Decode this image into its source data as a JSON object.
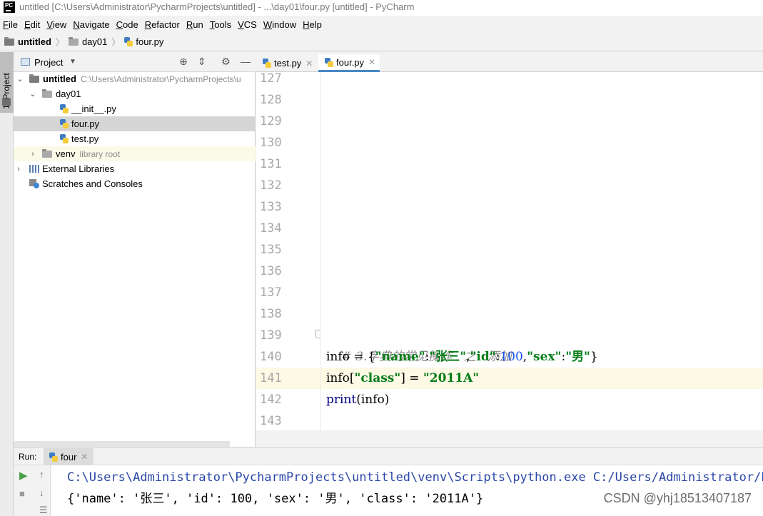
{
  "window": {
    "title": "untitled [C:\\Users\\Administrator\\PycharmProjects\\untitled] - ...\\day01\\four.py [untitled] - PyCharm",
    "logo_text": "PC"
  },
  "menubar": {
    "items": [
      {
        "label": "File",
        "mnemonic": "F",
        "rest": "ile"
      },
      {
        "label": "Edit",
        "mnemonic": "E",
        "rest": "dit"
      },
      {
        "label": "View",
        "mnemonic": "V",
        "rest": "iew"
      },
      {
        "label": "Navigate",
        "mnemonic": "N",
        "rest": "avigate"
      },
      {
        "label": "Code",
        "mnemonic": "C",
        "rest": "ode"
      },
      {
        "label": "Refactor",
        "mnemonic": "R",
        "rest": "efactor"
      },
      {
        "label": "Run",
        "mnemonic": "R",
        "rest": "un"
      },
      {
        "label": "Tools",
        "mnemonic": "T",
        "rest": "ools"
      },
      {
        "label": "VCS",
        "mnemonic": "V",
        "rest": "CS"
      },
      {
        "label": "Window",
        "mnemonic": "W",
        "rest": "indow"
      },
      {
        "label": "Help",
        "mnemonic": "H",
        "rest": "elp"
      }
    ]
  },
  "breadcrumb": {
    "project": "untitled",
    "folder": "day01",
    "file": "four.py"
  },
  "left_strip": {
    "tab_label": "1: Project"
  },
  "project_panel": {
    "title": "Project",
    "tree": {
      "root": {
        "label": "untitled",
        "path": "C:\\Users\\Administrator\\PycharmProjects\\u"
      },
      "day01": "day01",
      "init": "__init__.py",
      "four": "four.py",
      "test": "test.py",
      "venv": {
        "label": "venv",
        "note": "library root"
      },
      "external": "External Libraries",
      "scratches": "Scratches and Consoles"
    }
  },
  "editor_tabs": [
    {
      "label": "test.py",
      "active": false
    },
    {
      "label": "four.py",
      "active": true
    }
  ],
  "editor": {
    "line_numbers": [
      "127",
      "128",
      "129",
      "130",
      "131",
      "132",
      "133",
      "134",
      "135",
      "136",
      "137",
      "138",
      "139",
      "140",
      "141",
      "142",
      "143"
    ],
    "current_line": "141",
    "code": {
      "l139_comment": "# 3.字典的常见操作   之   添加",
      "l140_var": "info = {",
      "l140_k1": "\"name\"",
      "l140_c1": ":",
      "l140_v1": "\"张三\"",
      "l140_s1": ",",
      "l140_k2": "\"id\"",
      "l140_c2": ":",
      "l140_v2": "100",
      "l140_s2": ",",
      "l140_k3": "\"sex\"",
      "l140_c3": ":",
      "l140_v3": "\"男\"",
      "l140_end": "}",
      "l141_a": "info[",
      "l141_k": "\"class\"",
      "l141_b": "] = ",
      "l141_v": "\"2011A\"",
      "l142_fn": "print",
      "l142_args": "(info)"
    }
  },
  "run_panel": {
    "label": "Run:",
    "tab": "four",
    "console": {
      "line1": "C:\\Users\\Administrator\\PycharmProjects\\untitled\\venv\\Scripts\\python.exe C:/Users/Administrator/Pyc",
      "line2": "{'name': '张三', 'id': 100, 'sex': '男', 'class': '2011A'}"
    }
  },
  "watermark": "CSDN @yhj18513407187",
  "colors": {
    "accent_tab": "#4a88c7",
    "string_green": "#067d17",
    "number_blue": "#1750eb",
    "current_line_bg": "#fdf9e5",
    "selection_gray": "#d5d5d5"
  },
  "icons": [
    "pycharm-logo-icon",
    "folder-icon",
    "python-file-icon",
    "crosshair-icon",
    "collapse-icon",
    "gear-icon",
    "minimize-icon",
    "run-icon",
    "stop-icon",
    "up-arrow-icon",
    "down-arrow-icon",
    "library-icon",
    "scratch-icon"
  ]
}
